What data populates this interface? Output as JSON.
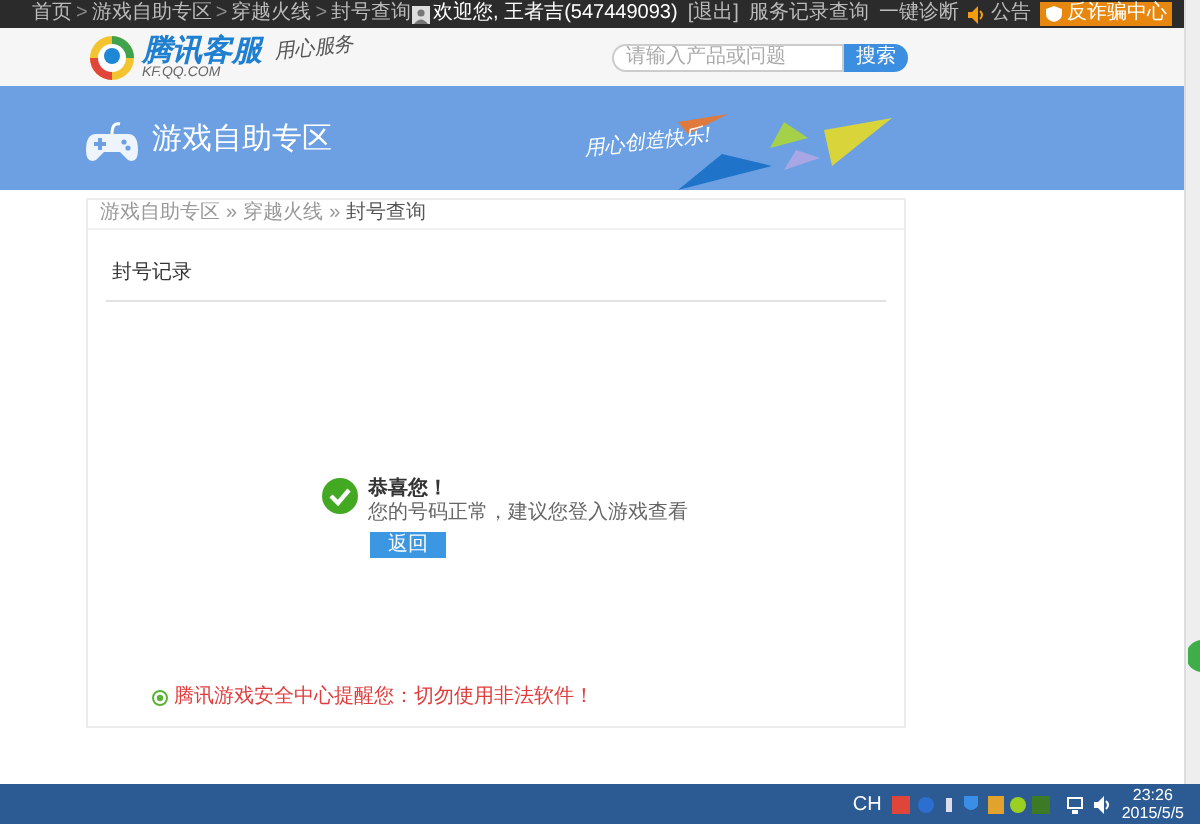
{
  "top_bar": {
    "breadcrumb": [
      "首页",
      "游戏自助专区",
      "穿越火线",
      "封号查询"
    ],
    "separator": ">",
    "welcome": "欢迎您, 王者吉(547449093)",
    "links": [
      "[退出]",
      "服务记录查询",
      "一键诊断"
    ],
    "notice": "公告",
    "anti_fraud": "反诈骗中心"
  },
  "header": {
    "logo_title": "腾讯客服",
    "logo_url": "KF.QQ.COM",
    "tagline": "用心服务",
    "search": {
      "placeholder": "请输入产品或问题"
    },
    "search_button": "搜索"
  },
  "banner": {
    "title": "游戏自助专区",
    "slogan": "用心创造快乐!"
  },
  "breadcrumb": {
    "items": [
      "游戏自助专区",
      "穿越火线",
      "封号查询"
    ],
    "separator": "»"
  },
  "section_title": "封号记录",
  "result": {
    "title": "恭喜您！",
    "message": "您的号码正常，建议您登入游戏查看",
    "button": "返回"
  },
  "warning": "腾讯游戏安全中心提醒您：切勿使用非法软件！",
  "taskbar": {
    "language": "CH",
    "time": "23:26",
    "date": "2015/5/5"
  }
}
